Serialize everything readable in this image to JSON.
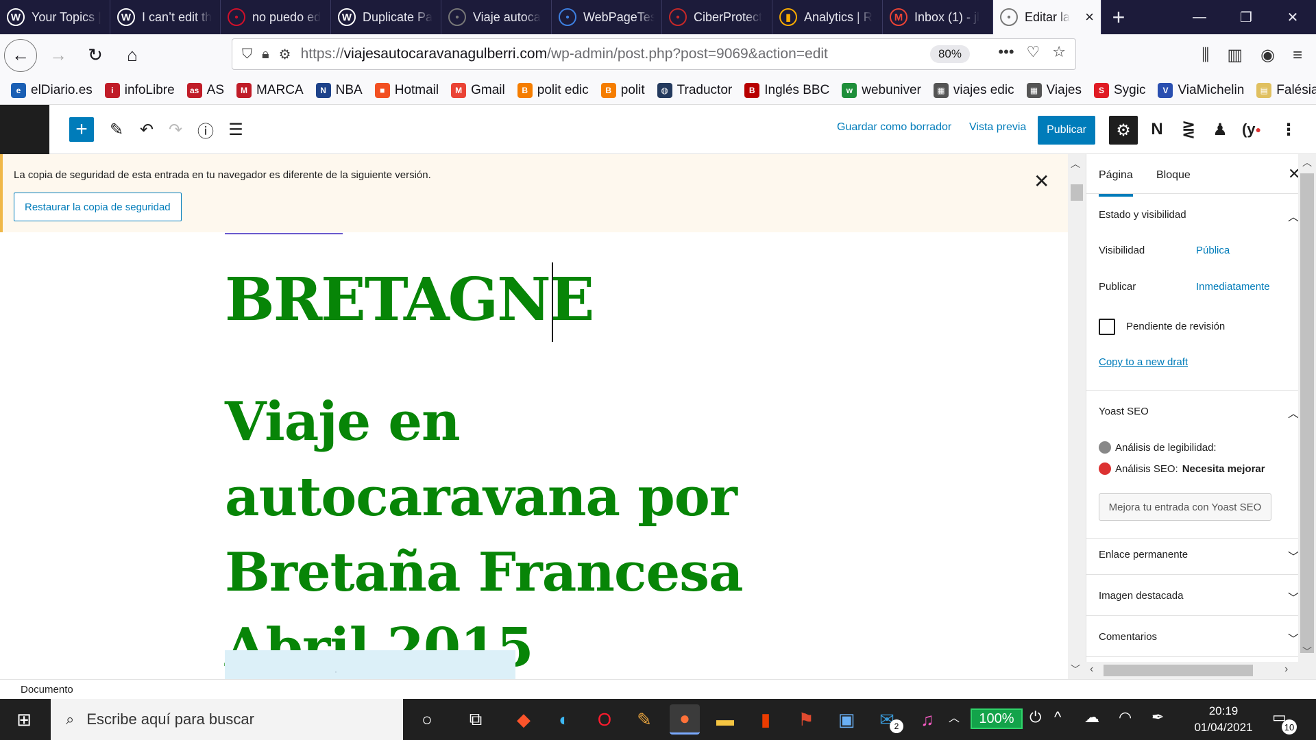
{
  "browser": {
    "tabs": [
      {
        "label": "Your Topics |",
        "icon": "wordpress-icon",
        "color": "#ffffff"
      },
      {
        "label": "I can’t edit th",
        "icon": "wordpress-icon",
        "color": "#ffffff"
      },
      {
        "label": "no puedo ed",
        "icon": "webnode-icon",
        "color": "#d0102a"
      },
      {
        "label": "Duplicate Pa",
        "icon": "wordpress-icon",
        "color": "#ffffff"
      },
      {
        "label": "Viaje autoca",
        "icon": "site-thumbnail-icon",
        "color": "#777777"
      },
      {
        "label": "WebPageTes",
        "icon": "webpagetest-icon",
        "color": "#3d7fe0"
      },
      {
        "label": "CiberProtect",
        "icon": "shield-icon",
        "color": "#c62828"
      },
      {
        "label": "Analytics | R",
        "icon": "analytics-icon",
        "color": "#f9ab00"
      },
      {
        "label": "Inbox (1) - jl",
        "icon": "gmail-icon",
        "color": "#ea4335"
      },
      {
        "label": "Editar la",
        "icon": "site-thumbnail-icon",
        "color": "#777777",
        "active": true
      }
    ],
    "url_prefix": "https://",
    "url_host": "viajesautocaravanagulberri.com",
    "url_path": "/wp-admin/post.php?post=9069&action=edit",
    "zoom": "80%",
    "bookmarks": [
      {
        "label": "elDiario.es",
        "icon": "eldiario-icon",
        "color": "#1a5fb4",
        "glyph": "e"
      },
      {
        "label": "infoLibre",
        "icon": "infolibre-icon",
        "color": "#c01c28",
        "glyph": "i"
      },
      {
        "label": "AS",
        "icon": "as-icon",
        "color": "#c01c28",
        "glyph": "as"
      },
      {
        "label": "MARCA",
        "icon": "marca-icon",
        "color": "#c01c28",
        "glyph": "M"
      },
      {
        "label": "NBA",
        "icon": "nba-icon",
        "color": "#1d428a",
        "glyph": "N"
      },
      {
        "label": "Hotmail",
        "icon": "microsoft-icon",
        "color": "#f25022",
        "glyph": "■"
      },
      {
        "label": "Gmail",
        "icon": "gmail-icon",
        "color": "#ea4335",
        "glyph": "M"
      },
      {
        "label": "polit edic",
        "icon": "blogger-icon",
        "color": "#f57d00",
        "glyph": "B"
      },
      {
        "label": "polit",
        "icon": "blogger-icon",
        "color": "#f57d00",
        "glyph": "B"
      },
      {
        "label": "Traductor",
        "icon": "globe-icon",
        "color": "#243a5e",
        "glyph": "◍"
      },
      {
        "label": "Inglés BBC",
        "icon": "bbc-icon",
        "color": "#b80000",
        "glyph": "B"
      },
      {
        "label": "webuniver",
        "icon": "webuniver-icon",
        "color": "#1f8f3a",
        "glyph": "w"
      },
      {
        "label": "viajes edic",
        "icon": "site-thumbnail-icon",
        "color": "#555555",
        "glyph": "▦"
      },
      {
        "label": "Viajes",
        "icon": "site-thumbnail-icon",
        "color": "#555555",
        "glyph": "▦"
      },
      {
        "label": "Sygic",
        "icon": "sygic-icon",
        "color": "#e01b24",
        "glyph": "S"
      },
      {
        "label": "ViaMichelin",
        "icon": "michelin-icon",
        "color": "#2a4fb0",
        "glyph": "V"
      },
      {
        "label": "Falésia",
        "icon": "folder-icon",
        "color": "#e0c060",
        "glyph": "▤"
      }
    ]
  },
  "toolbar": {
    "save_draft": "Guardar como borrador",
    "preview": "Vista previa",
    "publish": "Publicar",
    "yoast_badge": "(y"
  },
  "notice": {
    "text": "La copia de seguridad de esta entrada en tu navegador es diferente de la siguiente versión.",
    "button": "Restaurar la copia de seguridad"
  },
  "content": {
    "heading": "BRETAGNE",
    "title": "Viaje en autocaravana por Bretaña Francesa Abril 2015"
  },
  "sidebar": {
    "tab_page": "Página",
    "tab_block": "Bloque",
    "status_title": "Estado y visibilidad",
    "visibility_label": "Visibilidad",
    "visibility_value": "Pública",
    "publish_label": "Publicar",
    "publish_value": "Inmediatamente",
    "pending_review": "Pendiente de revisión",
    "copy_draft": "Copy to a new draft",
    "yoast_title": "Yoast SEO",
    "readability": "Análisis de legibilidad:",
    "seo_prefix": "Análisis SEO:",
    "seo_value": "Necesita mejorar",
    "yoast_button": "Mejora tu entrada con Yoast SEO",
    "permalink": "Enlace permanente",
    "featured_image": "Imagen destacada",
    "comments": "Comentarios"
  },
  "footer": {
    "breadcrumb": "Documento"
  },
  "taskbar": {
    "search_placeholder": "Escribe aquí para buscar",
    "battery": "100%",
    "time": "20:19",
    "date": "01/04/2021",
    "notifications": "10",
    "mail_badge": "2"
  }
}
